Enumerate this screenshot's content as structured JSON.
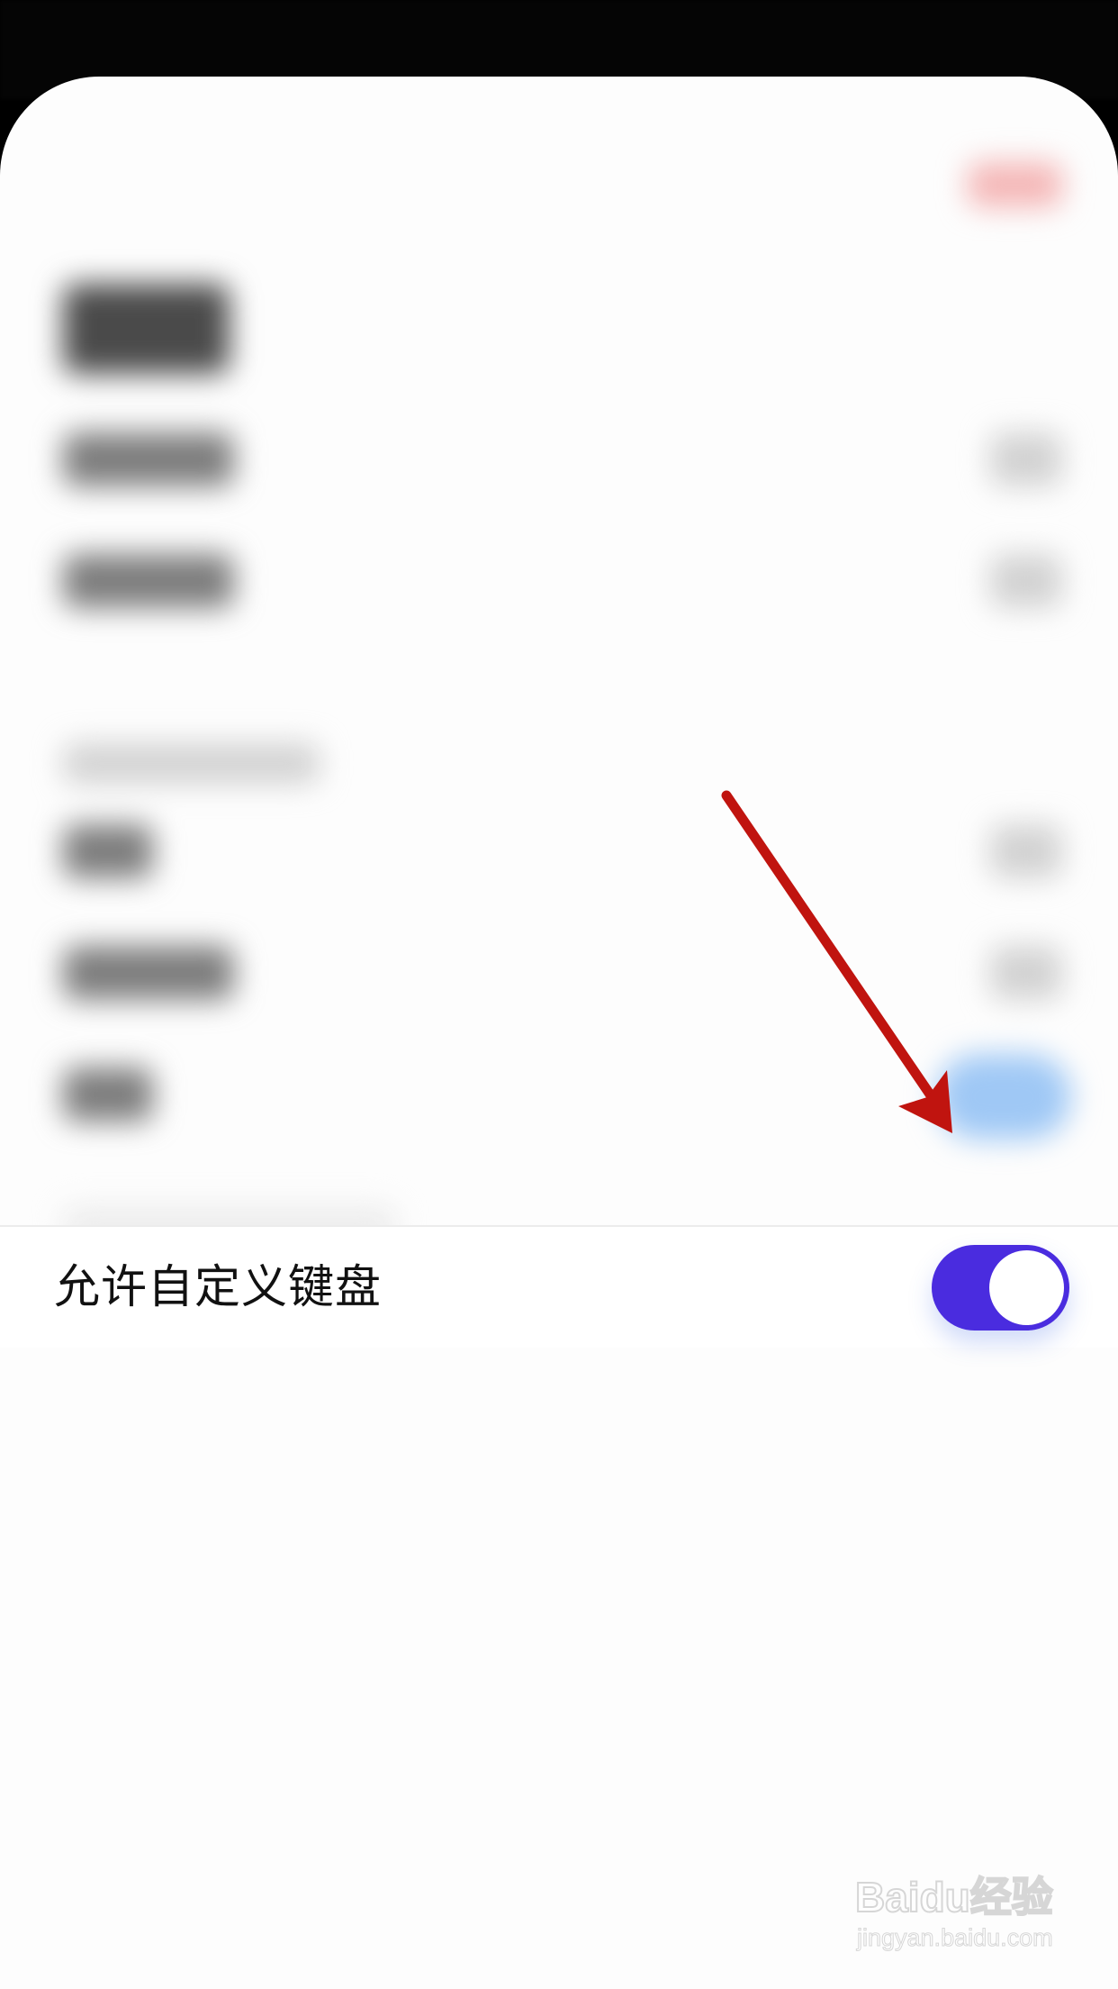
{
  "settings_row": {
    "label": "允许自定义键盘",
    "toggle_on": true
  },
  "colors": {
    "toggle_on": "#4a2cdf",
    "arrow": "#c0140f"
  },
  "watermark": {
    "logo": "Baidu经验",
    "url": "jingyan.baidu.com"
  }
}
